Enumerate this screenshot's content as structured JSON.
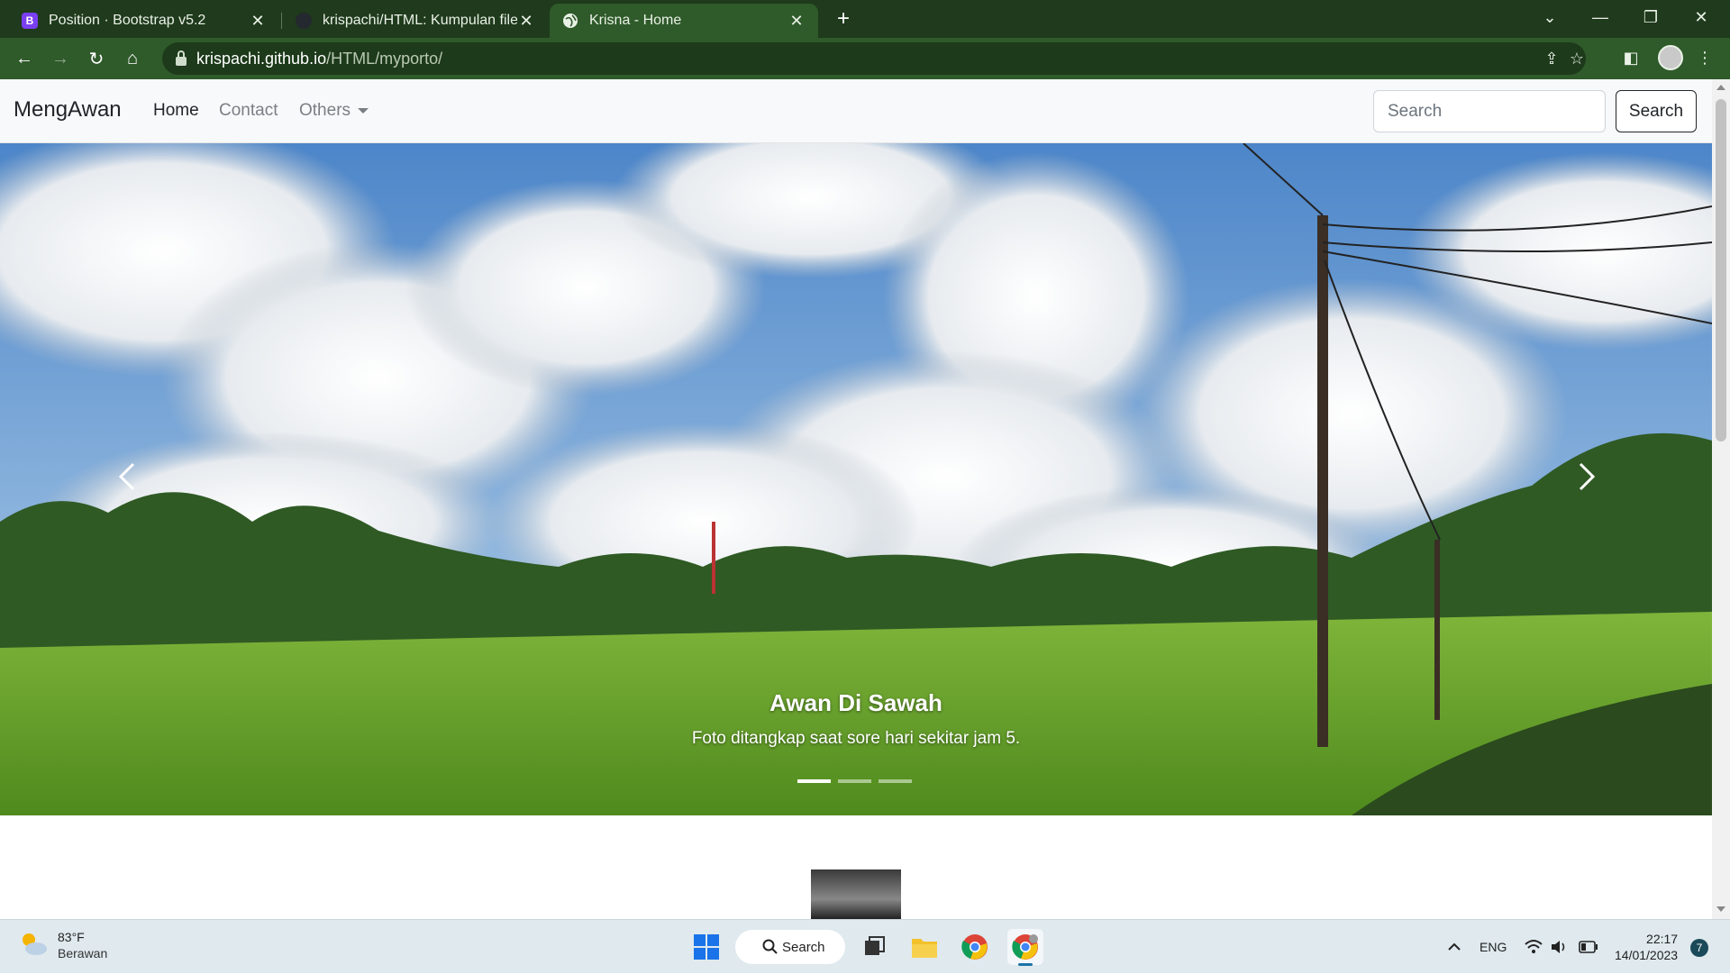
{
  "browser": {
    "tabs": [
      {
        "title": "Position · Bootstrap v5.2",
        "favicon": "bootstrap-icon"
      },
      {
        "title": "krispachi/HTML: Kumpulan file ht",
        "favicon": "github-icon"
      },
      {
        "title": "Krisna - Home",
        "favicon": "globe-icon"
      }
    ],
    "url_host": "krispachi.github.io",
    "url_path": "/HTML/myporto/"
  },
  "site": {
    "brand": "MengAwan",
    "nav": {
      "home": "Home",
      "contact": "Contact",
      "others": "Others"
    },
    "search": {
      "placeholder": "Search",
      "button": "Search"
    },
    "carousel": {
      "title": "Awan Di Sawah",
      "text": "Foto ditangkap saat sore hari sekitar jam 5.",
      "active_index": 0,
      "slide_count": 3
    }
  },
  "taskbar": {
    "weather_temp": "83°F",
    "weather_cond": "Berawan",
    "search_label": "Search",
    "lang": "ENG",
    "time": "22:17",
    "date": "14/01/2023",
    "notif_count": "7"
  },
  "colors": {
    "chrome_dark": "#1f3a1c",
    "chrome_toolbar": "#2f5a2a",
    "navbar_bg": "#f8f9fa"
  }
}
